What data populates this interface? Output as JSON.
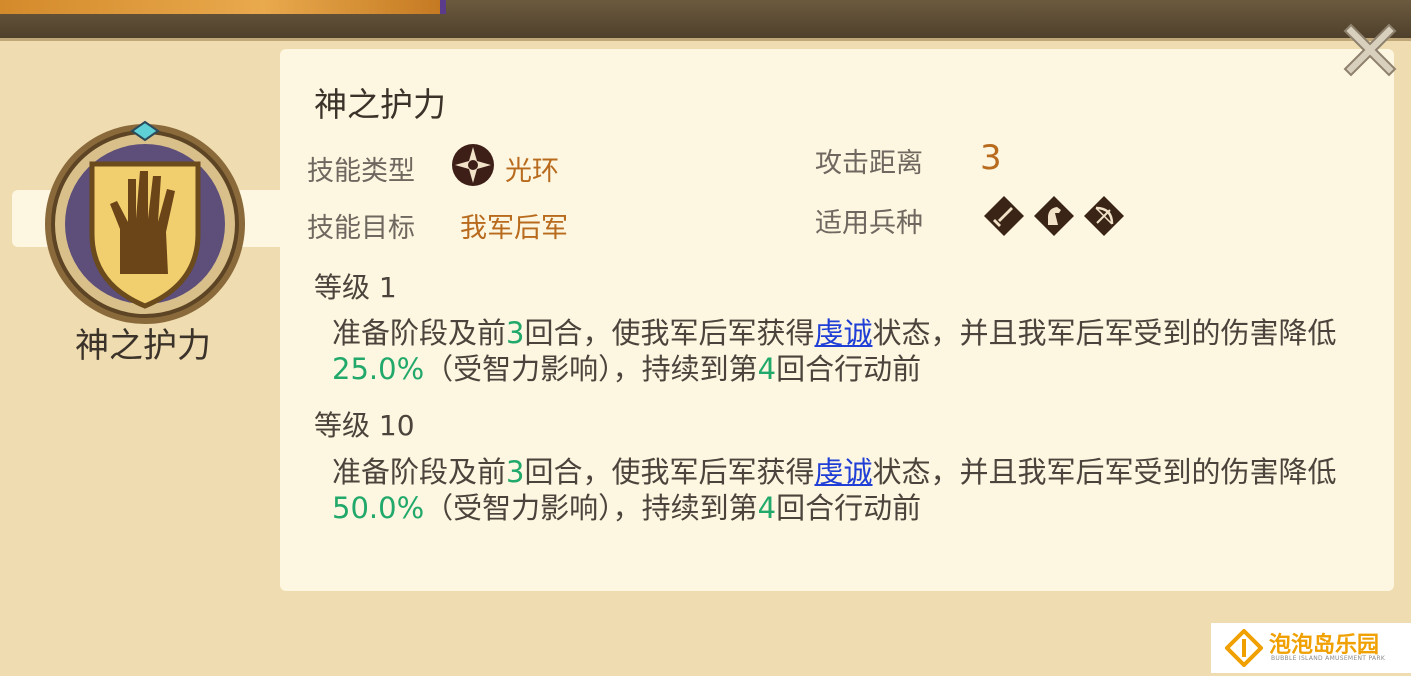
{
  "skill": {
    "title": "神之护力",
    "emblem_name": "神之护力",
    "type_label": "技能类型",
    "type_value": "光环",
    "type_icon": "aura-icon",
    "target_label": "技能目标",
    "target_value": "我军后军",
    "range_label": "攻击距离",
    "range_value": "3",
    "troops_label": "适用兵种",
    "troop_icons": [
      "sword-icon",
      "horse-icon",
      "bow-icon"
    ]
  },
  "levels": [
    {
      "label": "等级 1",
      "desc_a": "准备阶段及前",
      "rounds": "3",
      "desc_b": "回合，使我军后军获得",
      "status": "虔诚",
      "desc_c": "状态，并且我军后军受到的伤害降低",
      "percent": "25.0%",
      "desc_d": "（受智力影响），持续到第",
      "until": "4",
      "desc_e": "回合行动前"
    },
    {
      "label": "等级 10",
      "desc_a": "准备阶段及前",
      "rounds": "3",
      "desc_b": "回合，使我军后军获得",
      "status": "虔诚",
      "desc_c": "状态，并且我军后军受到的伤害降低",
      "percent": "50.0%",
      "desc_d": "（受智力影响），持续到第",
      "until": "4",
      "desc_e": "回合行动前"
    }
  ],
  "watermark": {
    "name": "泡泡岛乐园",
    "sub": "BUBBLE ISLAND AMUSEMENT PARK"
  },
  "colors": {
    "accent_orange": "#b86a1d",
    "value_green": "#21a86b",
    "link_blue": "#1f3fd6",
    "panel_bg": "#fdf6e0",
    "frame_bg": "#efdcb1"
  }
}
